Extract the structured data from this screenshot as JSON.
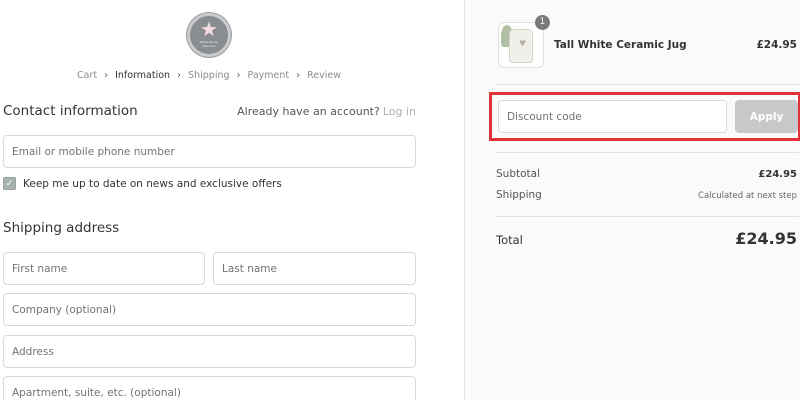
{
  "breadcrumb": {
    "items": [
      {
        "label": "Cart",
        "active": false
      },
      {
        "label": "Information",
        "active": true
      },
      {
        "label": "Shipping",
        "active": false
      },
      {
        "label": "Payment",
        "active": false
      },
      {
        "label": "Review",
        "active": false
      }
    ]
  },
  "logo": {
    "text": "White Peony Interiors"
  },
  "contact": {
    "title": "Contact information",
    "account_prompt": "Already have an account?",
    "login_link": "Log in",
    "email_placeholder": "Email or mobile phone number",
    "email_value": "",
    "newsletter_label": "Keep me up to date on news and exclusive offers",
    "newsletter_checked": true
  },
  "shipping": {
    "title": "Shipping address",
    "first_name_placeholder": "First name",
    "last_name_placeholder": "Last name",
    "company_placeholder": "Company (optional)",
    "address_placeholder": "Address",
    "apartment_placeholder": "Apartment, suite, etc. (optional)"
  },
  "order": {
    "product": {
      "name": "Tall White Ceramic Jug",
      "price": "£24.95",
      "quantity": "1"
    },
    "discount": {
      "placeholder": "Discount code",
      "apply_label": "Apply",
      "highlight_color": "#e1313b"
    },
    "subtotal_label": "Subtotal",
    "subtotal_value": "£24.95",
    "shipping_label": "Shipping",
    "shipping_value": "Calculated at next step",
    "total_label": "Total",
    "total_value": "£24.95"
  },
  "colors": {
    "apply_button": "#c8c8c8",
    "checkbox": "#a8b2ad",
    "link": "#a7b3b6"
  }
}
